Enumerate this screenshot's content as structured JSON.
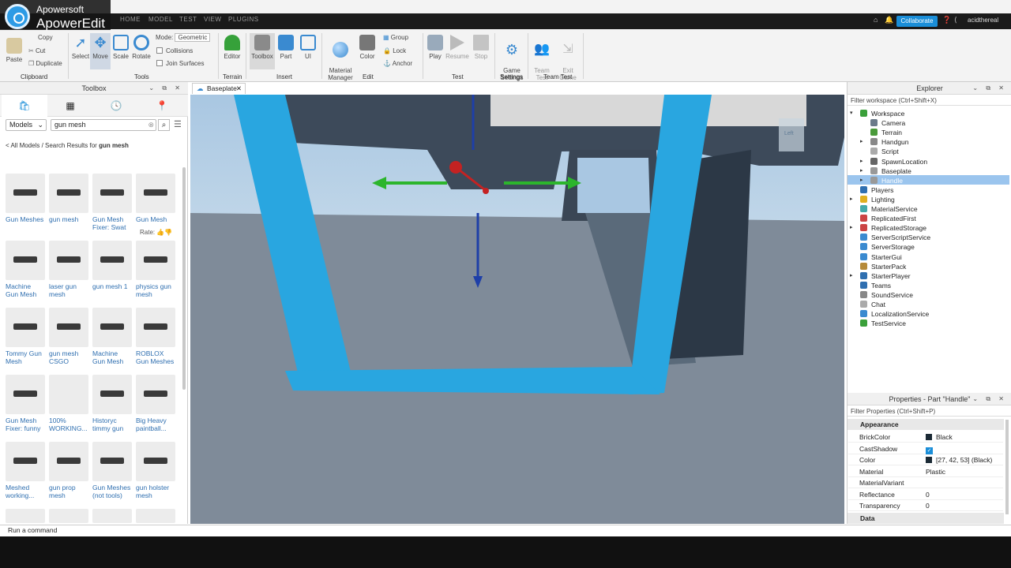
{
  "watermark": {
    "small": "Apowersoft",
    "big": "ApowerEdit"
  },
  "menu": [
    "HOME",
    "MODEL",
    "TEST",
    "VIEW",
    "PLUGINS"
  ],
  "topright": {
    "collaborate": "Collaborate",
    "user": "acidthereal"
  },
  "ribbon": {
    "clipboard": {
      "paste": "Paste",
      "copy": "Copy",
      "cut": "Cut",
      "duplicate": "Duplicate",
      "label": "Clipboard"
    },
    "tools": {
      "select": "Select",
      "move": "Move",
      "scale": "Scale",
      "rotate": "Rotate",
      "mode_label": "Mode:",
      "mode_value": "Geometric",
      "collisions": "Collisions",
      "join_surfaces": "Join Surfaces",
      "label": "Tools"
    },
    "terrain": {
      "editor": "Editor",
      "label": "Terrain"
    },
    "insert": {
      "toolbox": "Toolbox",
      "part": "Part",
      "ui": "UI",
      "label": "Insert"
    },
    "edit": {
      "material_manager": "Material\nManager",
      "color": "Color",
      "group": "Group",
      "lock": "Lock",
      "anchor": "Anchor",
      "label": "Edit"
    },
    "test": {
      "play": "Play",
      "resume": "Resume",
      "stop": "Stop",
      "label": "Test"
    },
    "settings": {
      "game_settings": "Game\nSettings",
      "label": "Settings"
    },
    "team_test": {
      "team_test": "Team\nTest",
      "exit_game": "Exit\nGame",
      "label": "Team Test"
    }
  },
  "toolbox": {
    "title": "Toolbox",
    "category": "Models",
    "search_value": "gun mesh",
    "breadcrumb_prefix": "< All Models / Search Results for ",
    "breadcrumb_query": "gun mesh",
    "rate_label": "Rate:",
    "items": [
      {
        "label": "Gun Meshes"
      },
      {
        "label": "gun mesh"
      },
      {
        "label": "Gun Mesh Fixer: Swat"
      },
      {
        "label": "Gun Mesh"
      },
      {
        "label": "Machine Gun Mesh"
      },
      {
        "label": "laser gun mesh"
      },
      {
        "label": "gun mesh 1"
      },
      {
        "label": "physics gun mesh"
      },
      {
        "label": "Tommy Gun Mesh"
      },
      {
        "label": "gun mesh CSGO"
      },
      {
        "label": "Machine Gun Mesh"
      },
      {
        "label": "ROBLOX Gun Meshes"
      },
      {
        "label": "Gun Mesh Fixer: funny"
      },
      {
        "label": "100% WORKING..."
      },
      {
        "label": "Historyc timmy gun"
      },
      {
        "label": "Big Heavy paintball..."
      },
      {
        "label": "Meshed working..."
      },
      {
        "label": "gun prop mesh"
      },
      {
        "label": "Gun Meshes (not tools)"
      },
      {
        "label": "gun holster mesh"
      }
    ]
  },
  "viewport": {
    "tab": "Baseplate",
    "cube_label": "Left"
  },
  "explorer": {
    "title": "Explorer",
    "filter": "Filter workspace (Ctrl+Shift+X)",
    "items": [
      {
        "label": "Workspace",
        "color": "#3aa03a"
      },
      {
        "label": "Camera",
        "color": "#6b7a8a"
      },
      {
        "label": "Terrain",
        "color": "#4a9a3a"
      },
      {
        "label": "Handgun",
        "color": "#888"
      },
      {
        "label": "Script",
        "color": "#aaa"
      },
      {
        "label": "SpawnLocation",
        "color": "#666"
      },
      {
        "label": "Baseplate",
        "color": "#999"
      },
      {
        "label": "Handle",
        "color": "#999"
      },
      {
        "label": "Players",
        "color": "#2f6fb0"
      },
      {
        "label": "Lighting",
        "color": "#e0b020"
      },
      {
        "label": "MaterialService",
        "color": "#4aa"
      },
      {
        "label": "ReplicatedFirst",
        "color": "#c44"
      },
      {
        "label": "ReplicatedStorage",
        "color": "#c44"
      },
      {
        "label": "ServerScriptService",
        "color": "#3a8ad0"
      },
      {
        "label": "ServerStorage",
        "color": "#3a8ad0"
      },
      {
        "label": "StarterGui",
        "color": "#3a8ad0"
      },
      {
        "label": "StarterPack",
        "color": "#b58a3a"
      },
      {
        "label": "StarterPlayer",
        "color": "#2f6fb0"
      },
      {
        "label": "Teams",
        "color": "#2f6fb0"
      },
      {
        "label": "SoundService",
        "color": "#888"
      },
      {
        "label": "Chat",
        "color": "#aaa"
      },
      {
        "label": "LocalizationService",
        "color": "#3a8ad0"
      },
      {
        "label": "TestService",
        "color": "#3aa03a"
      }
    ]
  },
  "properties": {
    "title": "Properties - Part \"Handle\"",
    "filter": "Filter Properties (Ctrl+Shift+P)",
    "section_appearance": "Appearance",
    "section_data": "Data",
    "rows": [
      {
        "name": "BrickColor",
        "value": "Black"
      },
      {
        "name": "CastShadow",
        "value": ""
      },
      {
        "name": "Color",
        "value": "[27, 42, 53] (Black)"
      },
      {
        "name": "Material",
        "value": "Plastic"
      },
      {
        "name": "MaterialVariant",
        "value": ""
      },
      {
        "name": "Reflectance",
        "value": "0"
      },
      {
        "name": "Transparency",
        "value": "0"
      }
    ]
  },
  "command": {
    "placeholder": "Run a command"
  }
}
